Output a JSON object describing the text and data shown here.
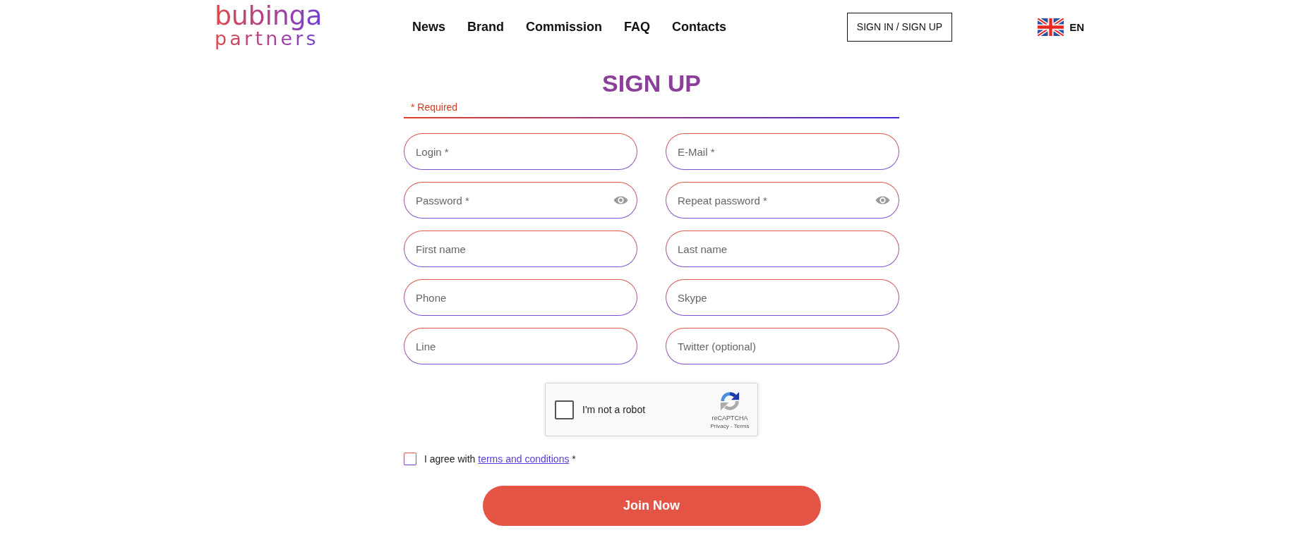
{
  "header": {
    "logo": {
      "line_1": "bubinga",
      "line_2": "partners"
    },
    "nav": [
      {
        "label": "News"
      },
      {
        "label": "Brand"
      },
      {
        "label": "Commission"
      },
      {
        "label": "FAQ"
      },
      {
        "label": "Contacts"
      }
    ],
    "auth_button": "SIGN IN / SIGN UP",
    "language": {
      "code": "EN"
    }
  },
  "form": {
    "title": "SIGN UP",
    "required_note": "* Required",
    "fields": [
      {
        "kind": "text",
        "placeholder": "Login *"
      },
      {
        "kind": "text",
        "placeholder": "E-Mail *"
      },
      {
        "kind": "password",
        "placeholder": "Password *"
      },
      {
        "kind": "password",
        "placeholder": "Repeat password *"
      },
      {
        "kind": "text",
        "placeholder": "First name"
      },
      {
        "kind": "text",
        "placeholder": "Last name"
      },
      {
        "kind": "text",
        "placeholder": "Phone"
      },
      {
        "kind": "text",
        "placeholder": "Skype"
      },
      {
        "kind": "text",
        "placeholder": "Line"
      },
      {
        "kind": "text",
        "placeholder": "Twitter (optional)"
      }
    ],
    "captcha": {
      "label": "I'm not a robot",
      "checked": false,
      "brand": "reCAPTCHA",
      "legal_links": "Privacy - Terms"
    },
    "agreement": {
      "checked": false,
      "text": "I agree with",
      "link": "terms and conditions",
      "suffix": "*"
    },
    "submit_button": "Join Now"
  }
}
